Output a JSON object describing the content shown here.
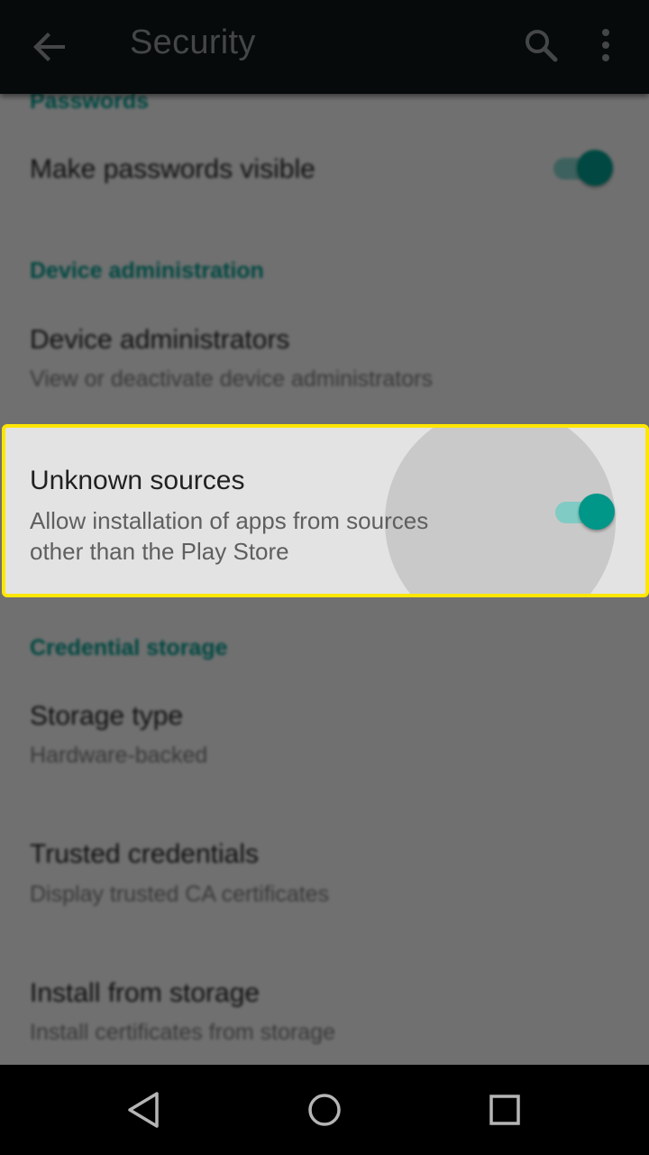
{
  "appbar": {
    "title": "Security",
    "icons": [
      "back-arrow-icon",
      "search-icon",
      "more-vert-icon"
    ]
  },
  "sections": {
    "passwords_header": "Passwords",
    "make_passwords_visible": {
      "title": "Make passwords visible",
      "enabled": true
    },
    "device_admin_header": "Device administration",
    "device_administrators": {
      "title": "Device administrators",
      "summary": "View or deactivate device administrators"
    },
    "unknown_sources": {
      "title": "Unknown sources",
      "summary_line1": "Allow installation of apps from sources",
      "summary_line2": "other than the Play Store",
      "enabled": true
    },
    "credential_storage_header": "Credential storage",
    "storage_type": {
      "title": "Storage type",
      "summary": "Hardware-backed"
    },
    "trusted_credentials": {
      "title": "Trusted credentials",
      "summary": "Display trusted CA certificates"
    },
    "install_from_storage": {
      "title": "Install from storage",
      "summary": "Install certificates from storage"
    }
  },
  "colors": {
    "accent": "#009688",
    "highlight_border": "#ffe600",
    "appbar_bg": "#0e1618"
  },
  "navbar": {
    "icons": [
      "back-triangle-icon",
      "home-circle-icon",
      "recents-square-icon"
    ]
  }
}
